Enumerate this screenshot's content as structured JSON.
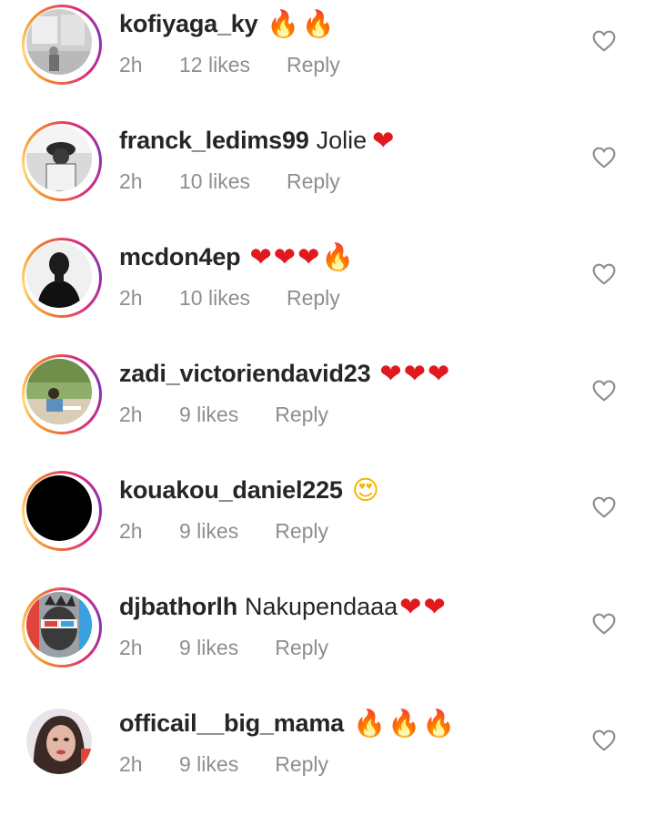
{
  "comments": [
    {
      "username": "kofiyaga_ky",
      "text": "",
      "emojis": [
        "🔥",
        "🔥"
      ],
      "time": "2h",
      "likes": "12 likes",
      "reply": "Reply",
      "ring": true,
      "avatar": "photo-room"
    },
    {
      "username": "franck_ledims99",
      "text": "Jolie",
      "emojis": [
        "❤"
      ],
      "time": "2h",
      "likes": "10 likes",
      "reply": "Reply",
      "ring": true,
      "avatar": "photo-bw-person"
    },
    {
      "username": "mcdon4ep",
      "text": "",
      "emojis": [
        "❤",
        "❤",
        "❤",
        "🔥"
      ],
      "time": "2h",
      "likes": "10 likes",
      "reply": "Reply",
      "ring": true,
      "avatar": "photo-portrait-bw"
    },
    {
      "username": "zadi_victoriendavid23",
      "text": "",
      "emojis": [
        "❤",
        "❤",
        "❤"
      ],
      "time": "2h",
      "likes": "9 likes",
      "reply": "Reply",
      "ring": true,
      "avatar": "photo-outdoor"
    },
    {
      "username": "kouakou_daniel225",
      "text": "",
      "emojis": [
        "😍"
      ],
      "time": "2h",
      "likes": "9 likes",
      "reply": "Reply",
      "ring": true,
      "avatar": "black"
    },
    {
      "username": "djbathorlh",
      "text": "Nakupendaaa",
      "emojis": [
        "❤",
        "❤"
      ],
      "time": "2h",
      "likes": "9 likes",
      "reply": "Reply",
      "ring": true,
      "avatar": "photo-glasses"
    },
    {
      "username": "officail__big_mama",
      "text": "",
      "emojis": [
        "🔥",
        "🔥",
        "🔥"
      ],
      "time": "2h",
      "likes": "9 likes",
      "reply": "Reply",
      "ring": false,
      "avatar": "photo-woman"
    }
  ],
  "icons": {
    "like": "heart-outline-icon",
    "fire": "fire-emoji",
    "heart": "red-heart-emoji",
    "face": "heart-eyes-emoji"
  },
  "colors": {
    "username": "#262626",
    "meta": "#8e8e8e",
    "heart": "#e0191f",
    "ring_start": "#f58529",
    "ring_end": "#dd2a7b"
  }
}
